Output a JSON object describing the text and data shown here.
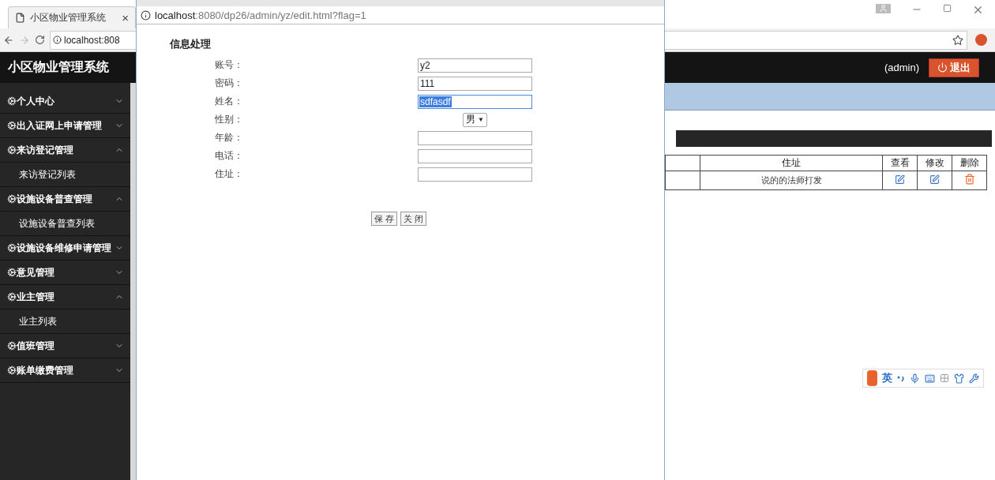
{
  "browser": {
    "tab": {
      "title": "小区物业管理系统",
      "close": "×"
    },
    "address": "localhost:808"
  },
  "app": {
    "title": "小区物业管理系统",
    "user": "(admin)",
    "logout": "退出",
    "menu": [
      {
        "label": "个人中心",
        "expanded": false
      },
      {
        "label": "出入证网上申请管理",
        "expanded": false
      },
      {
        "label": "来访登记管理",
        "expanded": true,
        "children": [
          {
            "label": "来访登记列表"
          }
        ]
      },
      {
        "label": "设施设备普查管理",
        "expanded": true,
        "children": [
          {
            "label": "设施设备普查列表"
          }
        ]
      },
      {
        "label": "设施设备维修申请管理",
        "expanded": false
      },
      {
        "label": "意见管理",
        "expanded": false
      },
      {
        "label": "业主管理",
        "expanded": true,
        "children": [
          {
            "label": "业主列表"
          }
        ]
      },
      {
        "label": "值班管理",
        "expanded": false
      },
      {
        "label": "账单缴费管理",
        "expanded": false
      }
    ],
    "table": {
      "columns": [
        "住址",
        "查看",
        "修改",
        "删除"
      ],
      "rows": [
        {
          "address": "说的的法师打发"
        }
      ]
    },
    "ime": {
      "mode": "英"
    }
  },
  "popup": {
    "address_host": "localhost",
    "address_rest": ":8080/dp26/admin/yz/edit.html?flag=1",
    "form": {
      "title": "信息处理",
      "fields": [
        {
          "label": "账号：",
          "kind": "text",
          "value": "y2",
          "focused": false
        },
        {
          "label": "密码：",
          "kind": "text",
          "value": "111",
          "focused": false
        },
        {
          "label": "姓名：",
          "kind": "text",
          "value": "sdfasdf",
          "focused": true
        },
        {
          "label": "性别：",
          "kind": "select",
          "value": "男",
          "arrow": "▼"
        },
        {
          "label": "年龄：",
          "kind": "text",
          "focused": false
        },
        {
          "label": "电话：",
          "kind": "text",
          "focused": false
        },
        {
          "label": "住址：",
          "kind": "text",
          "focused": false
        }
      ],
      "buttons": [
        "保 存",
        "关 闭"
      ]
    }
  }
}
